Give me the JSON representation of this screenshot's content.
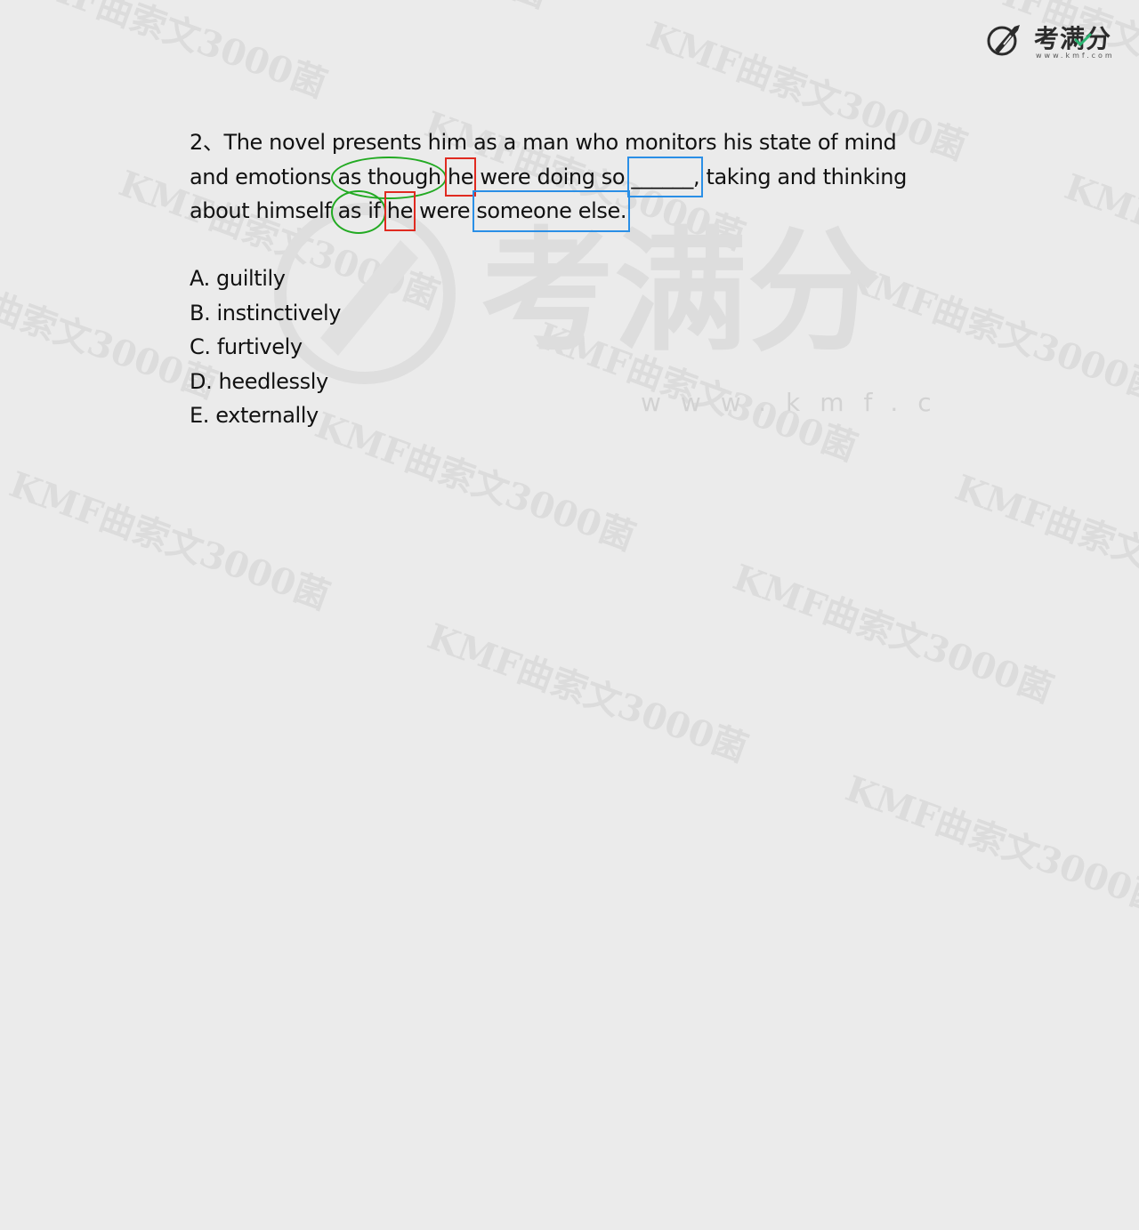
{
  "logo": {
    "text": "考满分",
    "url": "www.kmf.com"
  },
  "watermark": {
    "text": "KMF曲索文3000菌",
    "big_mark_text": "考满分",
    "big_mark_url": "www.kmf.com"
  },
  "question": {
    "number": "2、",
    "line1": "The novel presents him as a man who monitors his state of mind",
    "line2": {
      "a": "and emotions ",
      "circle1": "as though",
      "b": " ",
      "box1": "he",
      "c": " were doing so ",
      "blank": "______,",
      "d": " taking and thinking"
    },
    "line3": {
      "a": "about himself ",
      "circle2": "as if",
      "b": " ",
      "box2": "he",
      "c": " were ",
      "box3": "someone else."
    }
  },
  "choices": [
    "A. guiltily",
    "B. instinctively",
    "C. furtively",
    "D. heedlessly",
    "E. externally"
  ],
  "colors": {
    "background": "#ebebeb",
    "box_red": "#e02a20",
    "box_blue": "#2a8fe6",
    "circle_green": "#22aa22"
  }
}
